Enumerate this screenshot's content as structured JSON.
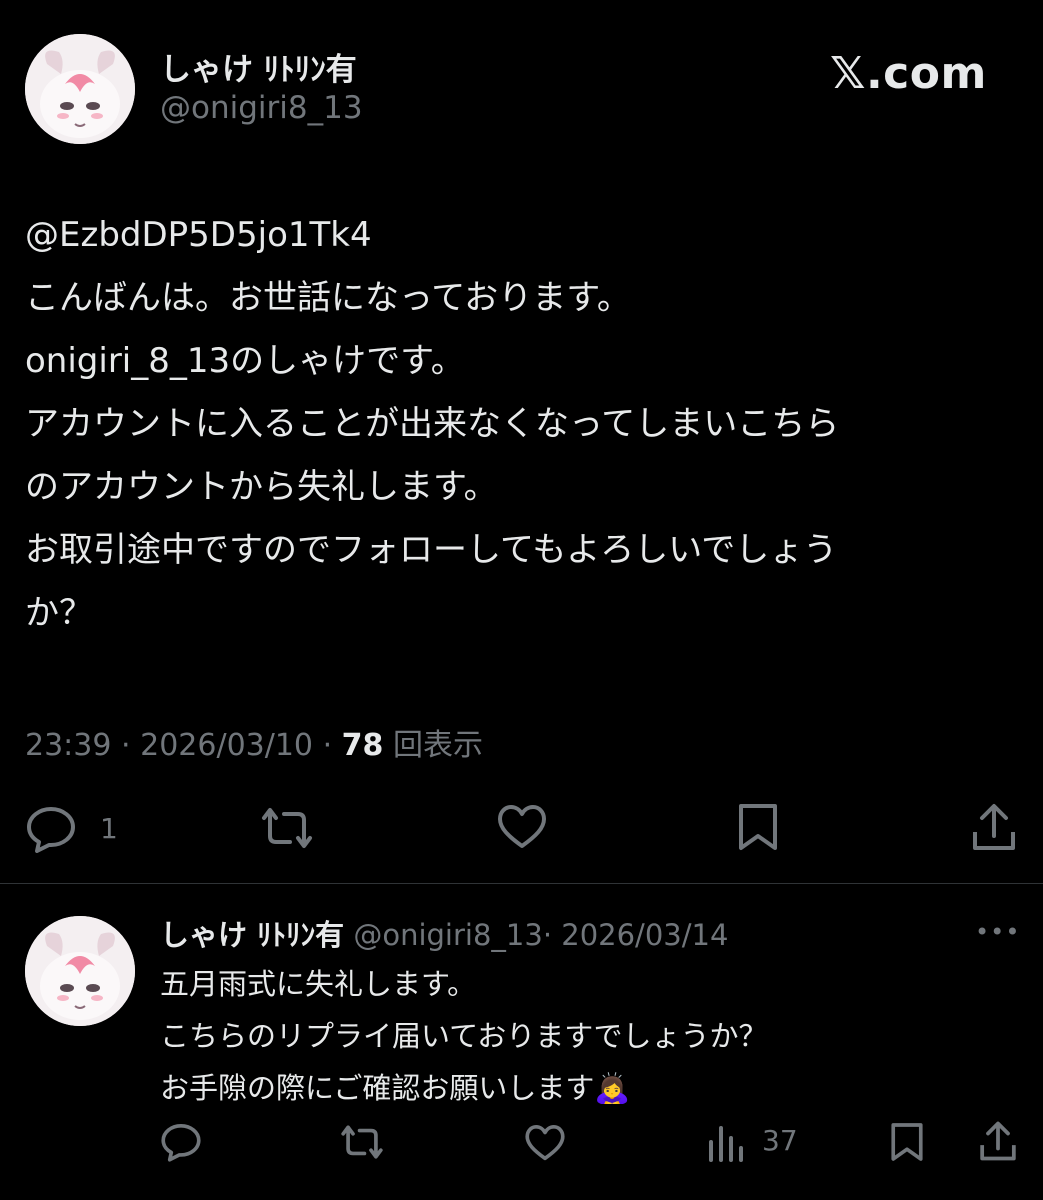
{
  "brand": {
    "label": "𝕏.com"
  },
  "main_tweet": {
    "author_name": "しゃけ ﾘﾄﾘﾝ有",
    "author_handle": "@onigiri8_13",
    "mention": "@EzbdDP5D5jo1Tk4",
    "lines": [
      "こんばんは。お世話になっております。",
      "onigiri_8_13のしゃけです。",
      "アカウントに入ることが出来なくなってしまいこちら",
      "のアカウントから失礼します。",
      "お取引途中ですのでフォローしてもよろしいでしょう",
      "か？"
    ],
    "time": "23:39",
    "date": "2026/03/10",
    "sep": "·",
    "views_count": "78",
    "views_label": "回表示",
    "reply_count": "1"
  },
  "reply_tweet": {
    "author_name": "しゃけ ﾘﾄﾘﾝ有",
    "author_handle": "@onigiri8_13",
    "date": "· 2026/03/14",
    "lines": [
      "五月雨式に失礼します。",
      "こちらのリプライ届いておりますでしょうか？",
      "お手隙の際にご確認お願いします🙇‍♀️"
    ],
    "views_count": "37",
    "more_label": "•••"
  }
}
